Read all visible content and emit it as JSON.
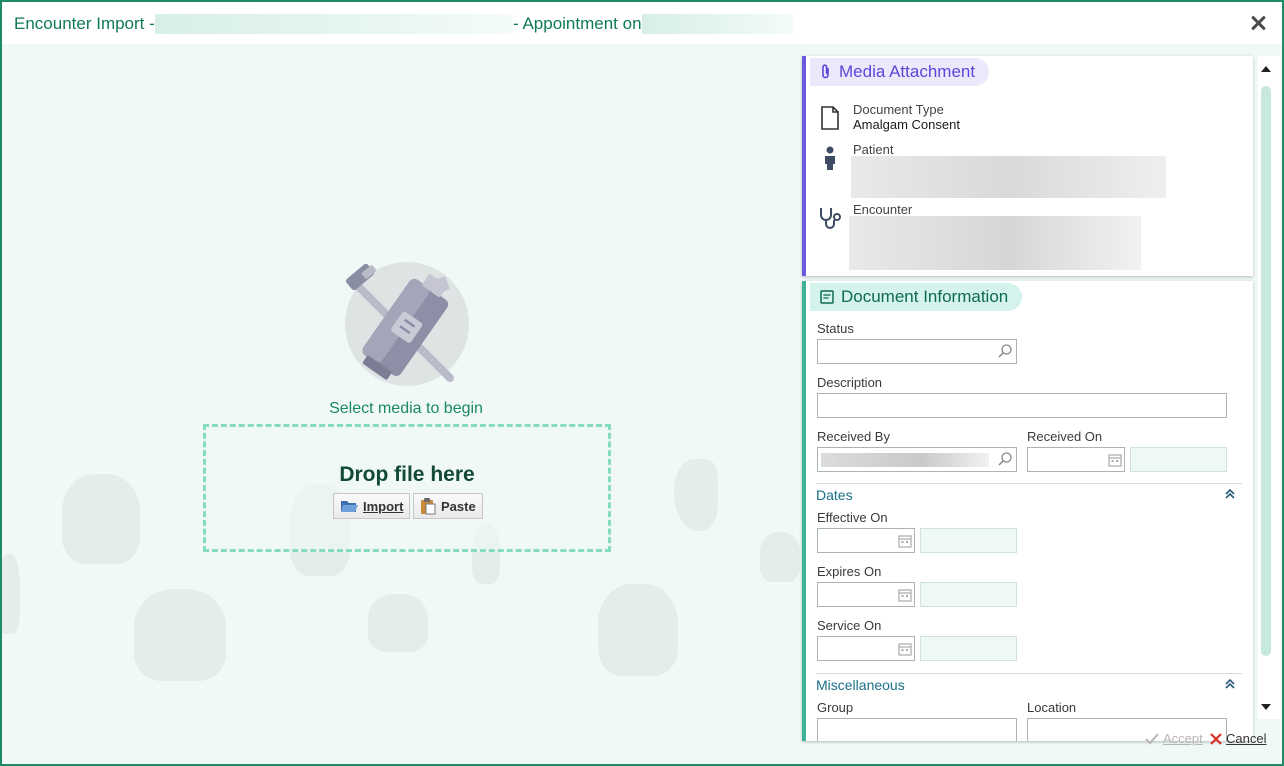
{
  "window": {
    "title_prefix": "Encounter Import -",
    "title_middle": "- Appointment on"
  },
  "media_area": {
    "prompt": "Select media to begin",
    "drop_text": "Drop file here",
    "import_label": "Import",
    "paste_label": "Paste"
  },
  "media_attachment": {
    "heading": "Media Attachment",
    "document_type_label": "Document Type",
    "document_type_value": "Amalgam Consent",
    "patient_label": "Patient",
    "encounter_label": "Encounter"
  },
  "document_information": {
    "heading": "Document Information",
    "status_label": "Status",
    "description_label": "Description",
    "received_by_label": "Received By",
    "received_on_label": "Received On",
    "dates_section": "Dates",
    "effective_on_label": "Effective On",
    "expires_on_label": "Expires On",
    "service_on_label": "Service On",
    "misc_section": "Miscellaneous",
    "group_label": "Group",
    "location_label": "Location"
  },
  "footer": {
    "accept_label": "Accept",
    "cancel_label": "Cancel"
  },
  "colors": {
    "accent": "#1f8a66",
    "media_stripe": "#6a5ae0",
    "doc_stripe": "#3fb398",
    "cancel_red": "#d93025"
  }
}
